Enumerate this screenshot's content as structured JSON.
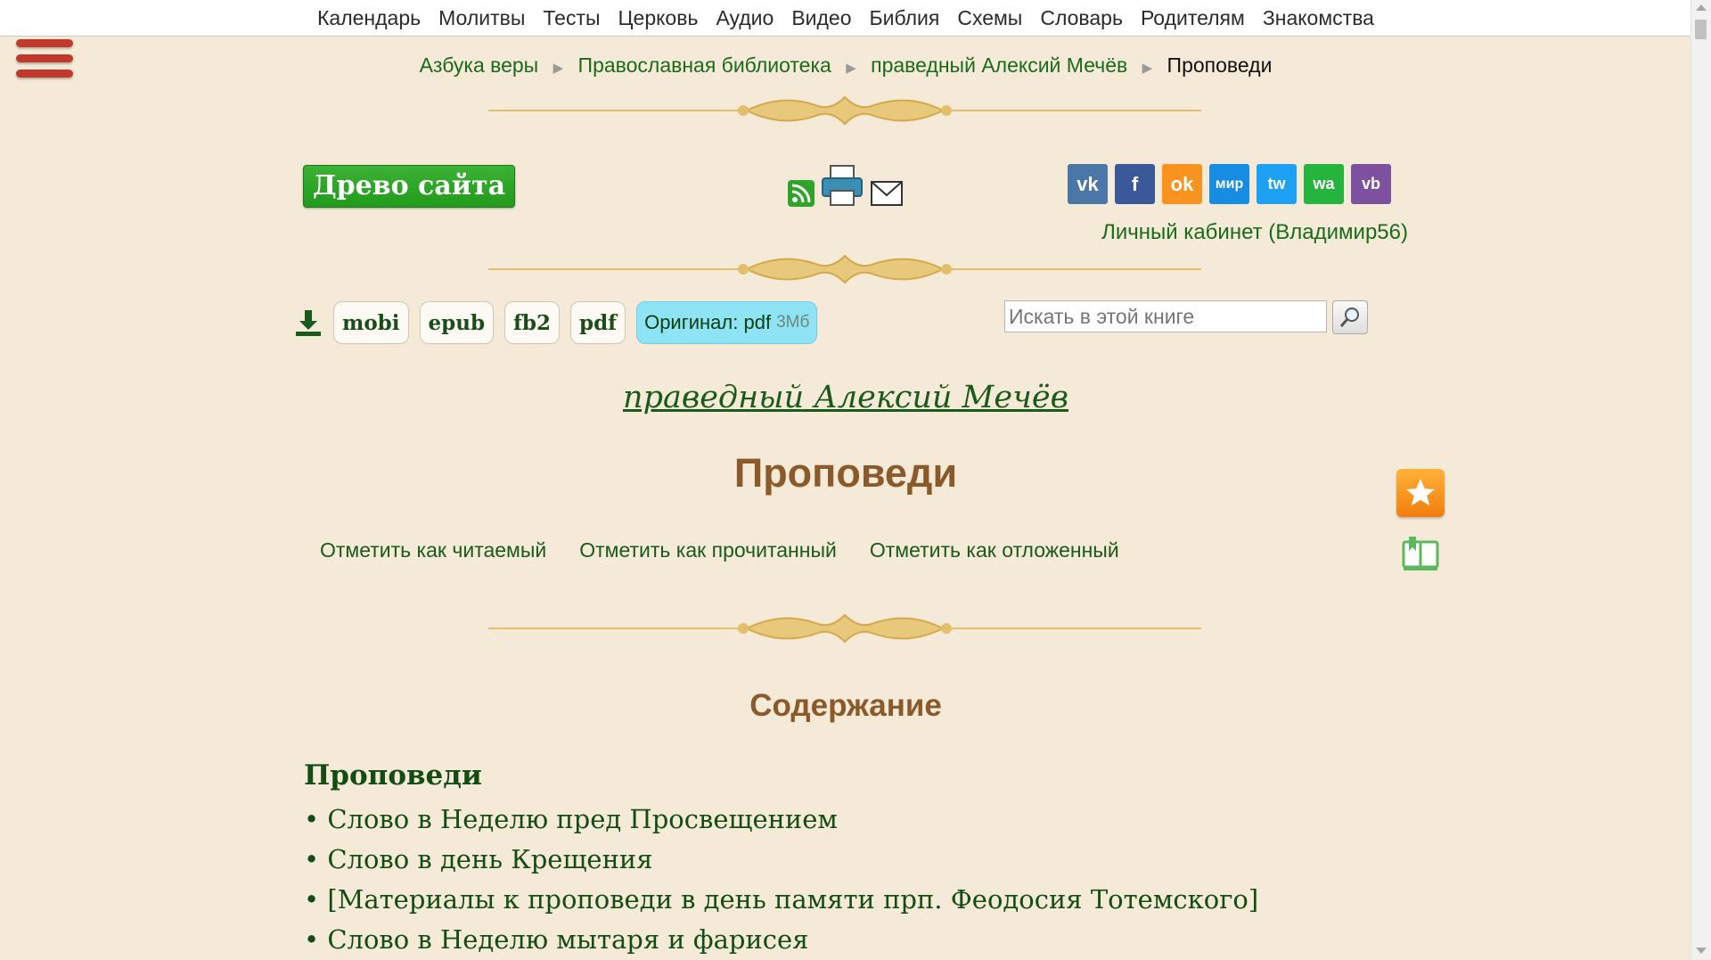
{
  "topnav": [
    "Календарь",
    "Молитвы",
    "Тесты",
    "Церковь",
    "Аудио",
    "Видео",
    "Библия",
    "Схемы",
    "Словарь",
    "Родителям",
    "Знакомства"
  ],
  "breadcrumb": {
    "items": [
      "Азбука веры",
      "Православная библиотека",
      "праведный Алексий Мечёв"
    ],
    "current": "Проповеди"
  },
  "tree_button": "Древо сайта",
  "icons": {
    "rss": "rss-icon",
    "print": "printer-icon",
    "mail": "envelope-icon"
  },
  "social": [
    {
      "name": "vk",
      "label": "vk",
      "color": "#4a76a8"
    },
    {
      "name": "facebook",
      "label": "f",
      "color": "#3b5998"
    },
    {
      "name": "odnoklassniki",
      "label": "ok",
      "color": "#f7931e"
    },
    {
      "name": "moimir",
      "label": "мир",
      "color": "#168de2"
    },
    {
      "name": "twitter",
      "label": "tw",
      "color": "#1da1f2"
    },
    {
      "name": "whatsapp",
      "label": "wa",
      "color": "#25b53f"
    },
    {
      "name": "viber",
      "label": "vb",
      "color": "#7d51a0"
    }
  ],
  "cabinet": "Личный кабинет (Владимир56)",
  "downloads": {
    "formats": [
      "mobi",
      "epub",
      "fb2",
      "pdf"
    ],
    "original_label": "Оригинал: pdf",
    "original_size": "3Мб"
  },
  "search": {
    "placeholder": "Искать в этой книге"
  },
  "author": "праведный Алексий Мечёв",
  "title": "Проповеди",
  "marks": [
    "Отметить как читаемый",
    "Отметить как прочитанный",
    "Отметить как отложенный"
  ],
  "toc": {
    "heading": "Содержание",
    "section": "Проповеди",
    "items": [
      "Слово в Неделю пред Просвещением",
      "Слово в день Крещения",
      "[Материалы к проповеди в день памяти прп. Феодосия Тотемского]",
      "Слово в Неделю мытаря и фарисея"
    ]
  },
  "colors": {
    "background": "#f5e9d8",
    "link": "#1a6b1a",
    "heading": "#8b5a2b",
    "ornament": "#e3bf6c"
  }
}
